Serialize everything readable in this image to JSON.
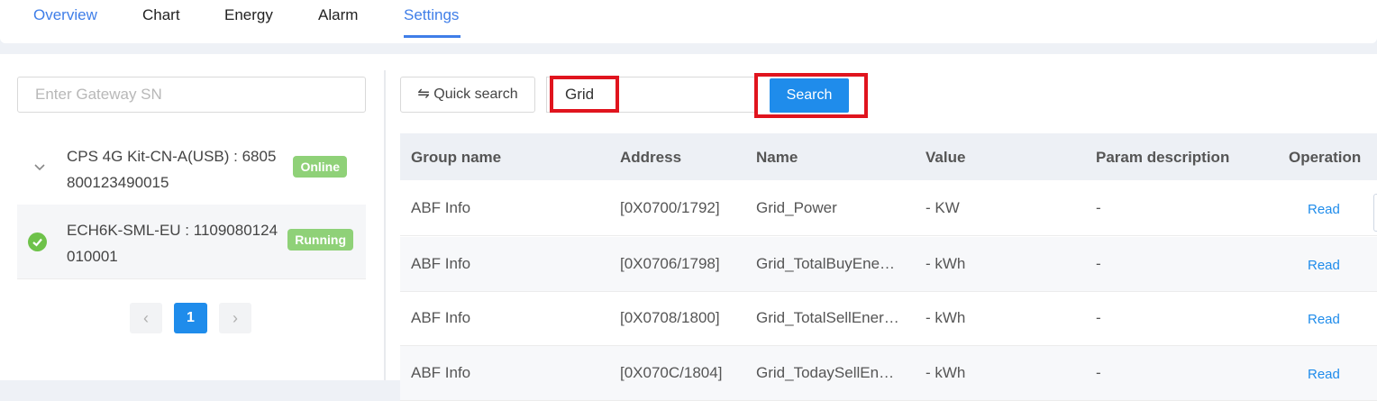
{
  "tabs": [
    {
      "label": "Overview"
    },
    {
      "label": "Chart"
    },
    {
      "label": "Energy"
    },
    {
      "label": "Alarm"
    },
    {
      "label": "Settings"
    }
  ],
  "left": {
    "sn_placeholder": "Enter Gateway SN",
    "devices": [
      {
        "name": "CPS 4G Kit-CN-A(USB) : 6805800123490015",
        "status": "Online",
        "icon": "chevron-down-icon"
      },
      {
        "name": "ECH6K-SML-EU : 1109080124010001",
        "status": "Running",
        "icon": "check-circle-icon"
      }
    ],
    "pager": {
      "prev": "‹",
      "current": "1",
      "next": "›"
    }
  },
  "toolbar": {
    "quick_search_label": "⇋ Quick search",
    "search_value": "Grid",
    "search_button": "Search"
  },
  "table": {
    "headers": [
      "Group name",
      "Address",
      "Name",
      "Value",
      "Param description",
      "Operation"
    ],
    "rows": [
      {
        "group": "ABF Info",
        "address": "[0X0700/1792]",
        "name": "Grid_Power",
        "value": "- KW",
        "desc": "-",
        "op": "Read"
      },
      {
        "group": "ABF Info",
        "address": "[0X0706/1798]",
        "name": "Grid_TotalBuyEne…",
        "value": "- kWh",
        "desc": "-",
        "op": "Read"
      },
      {
        "group": "ABF Info",
        "address": "[0X0708/1800]",
        "name": "Grid_TotalSellEner…",
        "value": "- kWh",
        "desc": "-",
        "op": "Read"
      },
      {
        "group": "ABF Info",
        "address": "[0X070C/1804]",
        "name": "Grid_TodaySellEn…",
        "value": "- kWh",
        "desc": "-",
        "op": "Read"
      }
    ]
  },
  "colors": {
    "accent": "#1f8ceb",
    "tab_active": "#3f7ee8",
    "highlight": "#e0141e",
    "status_green": "#8fd178"
  }
}
